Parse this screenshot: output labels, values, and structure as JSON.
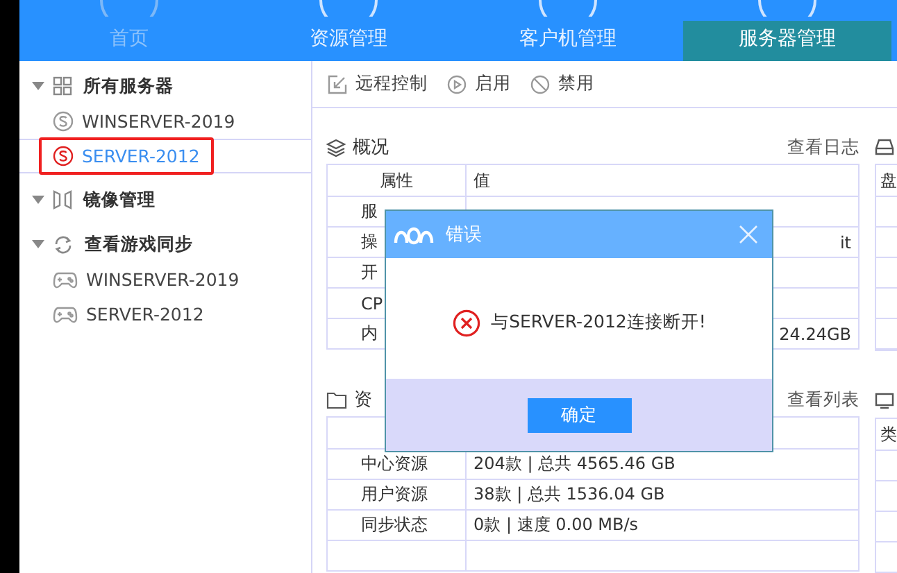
{
  "nav_tabs": [
    {
      "label": "首页",
      "selected": false,
      "disabled": true
    },
    {
      "label": "资源管理",
      "selected": false,
      "disabled": false
    },
    {
      "label": "客户机管理",
      "selected": false,
      "disabled": false
    },
    {
      "label": "服务器管理",
      "selected": true,
      "disabled": false
    }
  ],
  "sidebar": {
    "groups": [
      {
        "kind": "servers",
        "label": "所有服务器",
        "expanded": true,
        "children": [
          {
            "kind": "server",
            "label": "WINSERVER-2019",
            "selected": false
          },
          {
            "kind": "server",
            "label": "SERVER-2012",
            "selected": true,
            "highlighted": true
          }
        ]
      },
      {
        "kind": "mirror",
        "label": "镜像管理",
        "expanded": true
      },
      {
        "kind": "sync",
        "label": "查看游戏同步",
        "expanded": true,
        "children": [
          {
            "kind": "game",
            "label": "WINSERVER-2019",
            "selected": false
          },
          {
            "kind": "game",
            "label": "SERVER-2012",
            "selected": false
          }
        ]
      }
    ]
  },
  "toolbar": [
    {
      "kind": "remote",
      "label": "远程控制"
    },
    {
      "kind": "enable",
      "label": "启用"
    },
    {
      "kind": "disable",
      "label": "禁用"
    }
  ],
  "overview": {
    "title": "概况",
    "link": "查看日志",
    "columns": [
      "属性",
      "值"
    ],
    "rows": [
      {
        "label": "服"
      },
      {
        "label": "操",
        "value": "it"
      },
      {
        "label": "开"
      },
      {
        "label": "CP"
      },
      {
        "label": "内",
        "value": "24.24GB"
      }
    ]
  },
  "resources": {
    "title": "资",
    "link": "查看列表",
    "rows": [
      {
        "label": "中心资源",
        "value": "204款 | 总共 4565.46 GB"
      },
      {
        "label": "用户资源",
        "value": "38款 | 总共 1536.04 GB"
      },
      {
        "label": "同步状态",
        "value": "0款 | 速度 0.00 MB/s"
      },
      {}
    ]
  },
  "right_panels": [
    {
      "header": "盘"
    },
    {
      "header": "类"
    }
  ],
  "dialog": {
    "title": "错误",
    "message": "与SERVER-2012连接断开!",
    "button": "确定"
  }
}
